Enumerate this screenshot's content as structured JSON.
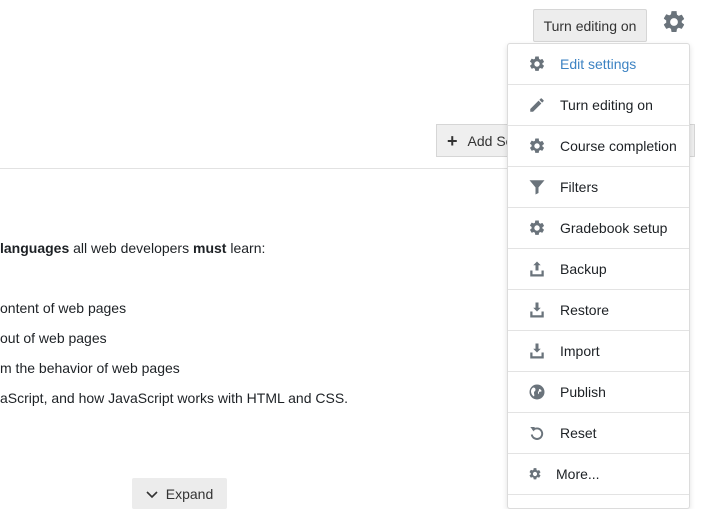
{
  "header": {
    "turn_editing_label": "Turn editing on"
  },
  "toolbar": {
    "add_section_label": "Add Se"
  },
  "content": {
    "lines": [
      {
        "parts": [
          {
            "t": " languages",
            "b": true
          },
          {
            "t": " all web developers ",
            "b": false
          },
          {
            "t": "must",
            "b": true
          },
          {
            "t": " learn:",
            "b": false
          }
        ]
      },
      {
        "parts": [
          {
            "t": "ontent of web pages",
            "b": false
          }
        ]
      },
      {
        "parts": [
          {
            "t": "out of web pages",
            "b": false
          }
        ]
      },
      {
        "parts": [
          {
            "t": "m the behavior of web pages",
            "b": false
          }
        ]
      },
      {
        "parts": [
          {
            "t": "aScript, and how JavaScript works with HTML and CSS.",
            "b": false
          }
        ]
      }
    ],
    "expand_label": "Expand"
  },
  "menu": {
    "items": [
      {
        "label": "Edit settings",
        "icon": "gear-icon",
        "active": true
      },
      {
        "label": "Turn editing on",
        "icon": "pencil-icon",
        "active": false
      },
      {
        "label": "Course completion",
        "icon": "gear-icon",
        "active": false
      },
      {
        "label": "Filters",
        "icon": "filter-icon",
        "active": false
      },
      {
        "label": "Gradebook setup",
        "icon": "gear-icon",
        "active": false
      },
      {
        "label": "Backup",
        "icon": "upload-icon",
        "active": false
      },
      {
        "label": "Restore",
        "icon": "download-icon",
        "active": false
      },
      {
        "label": "Import",
        "icon": "download-icon",
        "active": false
      },
      {
        "label": "Publish",
        "icon": "globe-icon",
        "active": false
      },
      {
        "label": "Reset",
        "icon": "reset-icon",
        "active": false
      },
      {
        "label": "More...",
        "icon": "gear-icon",
        "active": false
      }
    ]
  },
  "colors": {
    "accent": "#3d83c3",
    "icon": "#6a737b"
  }
}
